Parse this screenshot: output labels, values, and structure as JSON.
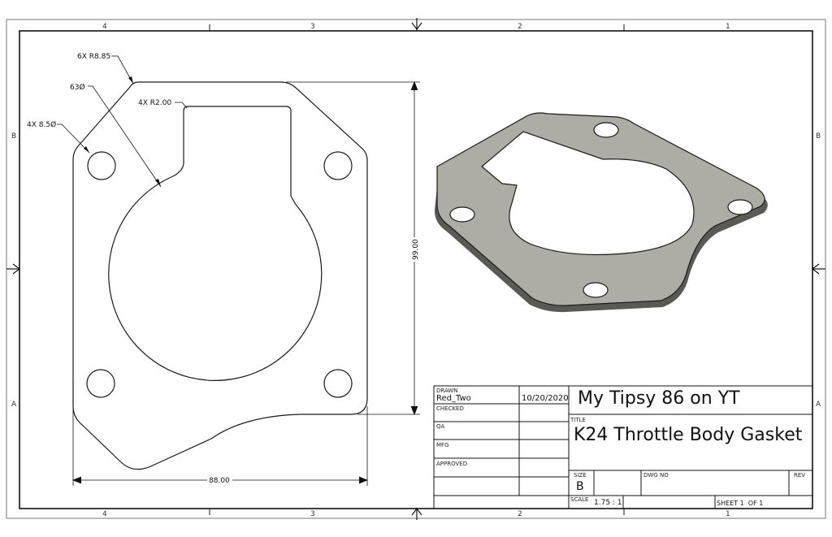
{
  "zones": {
    "top": [
      "4",
      "3",
      "2",
      "1"
    ],
    "bottom": [
      "4",
      "3",
      "2",
      "1"
    ],
    "left": [
      "B",
      "A"
    ],
    "right": [
      "B",
      "A"
    ]
  },
  "dimensions": {
    "fillet": "6X R8.85",
    "bore": "63Ø",
    "slot_radius": "4X R2.00",
    "holes": "4X 8.5Ø",
    "height": "99.00",
    "width": "88.00"
  },
  "title_block": {
    "drawn_label": "DRAWN",
    "drawn_by": "Red_Two",
    "drawn_date": "10/20/2020",
    "checked_label": "CHECKED",
    "qa_label": "QA",
    "mfg_label": "MFG",
    "approved_label": "APPROVED",
    "company": "My Tipsy 86 on YT",
    "title_label": "TITLE",
    "title": "K24 Throttle Body Gasket",
    "size_label": "SIZE",
    "size": "B",
    "dwg_label": "DWG NO",
    "rev_label": "REV",
    "scale_label": "SCALE",
    "scale": "1.75 : 1",
    "sheet": "SHEET 1  OF 1"
  },
  "colors": {
    "gasket_face": "#adada5",
    "gasket_edge": "#5a5a55",
    "outline": "#1a1a1a"
  }
}
